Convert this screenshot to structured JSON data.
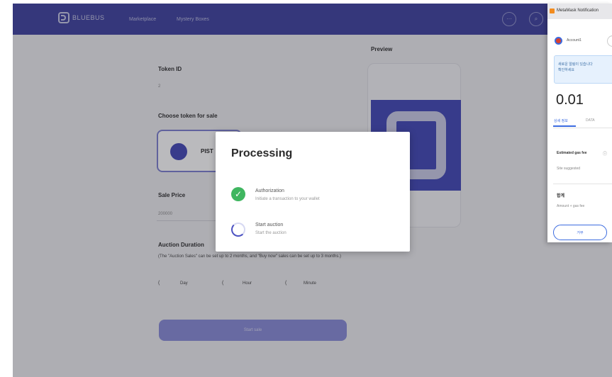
{
  "nav": {
    "logo": "BLUEBUS",
    "links": [
      "Marketplace",
      "Mystery Boxes"
    ]
  },
  "form": {
    "token_id_label": "Token ID",
    "token_id_value": "2",
    "choose_token_label": "Choose token for sale",
    "token_name": "PIST",
    "sale_price_label": "Sale Price",
    "sale_price_value": "200000",
    "auction_duration_label": "Auction Duration",
    "auction_note": "(The \"Auction Sales\" can be set up to 2 months, and \"Buy now\" sales can be set up to 3 months.)",
    "day_label": "Day",
    "hour_label": "Hour",
    "minute_label": "Minute",
    "submit_label": "Start sale"
  },
  "preview": {
    "label": "Preview"
  },
  "modal": {
    "title": "Processing",
    "steps": [
      {
        "title": "Authorization",
        "subtitle": "Initiate a transaction to your wallet",
        "status": "done"
      },
      {
        "title": "Start auction",
        "subtitle": "Start the auction",
        "status": "in-progress"
      }
    ]
  },
  "metamask": {
    "header": "MetaMask Notification",
    "account": "Account1",
    "notice": "새로운 알림이 있습니다\n확인하세요",
    "amount": "0.01",
    "tabs": [
      "상세 정보",
      "DATA"
    ],
    "fee_label": "Estimated gas fee",
    "fee_note": "Site suggested",
    "total_label": "합계",
    "total_note": "Amount + gas fee",
    "button": "거부",
    "accent_color": "#3b6be0"
  },
  "colors": {
    "brand": "#3c3f9e",
    "success": "#3fb660"
  }
}
